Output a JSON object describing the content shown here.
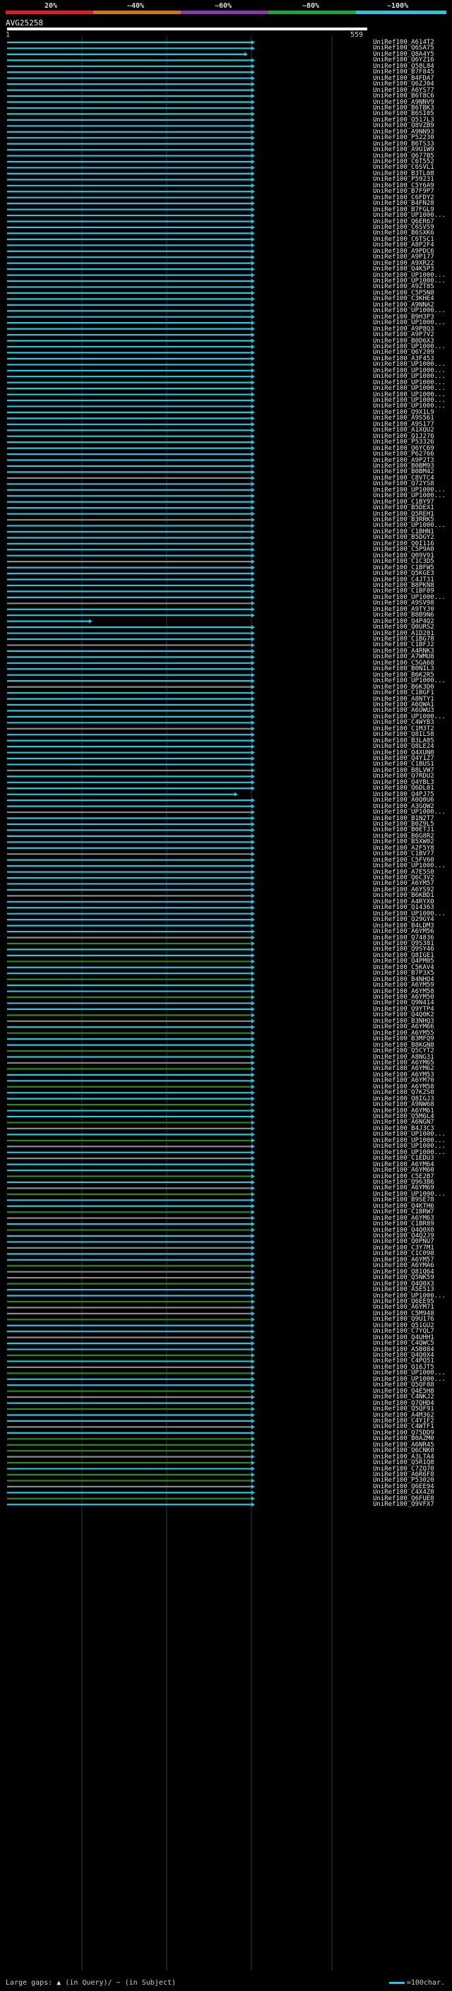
{
  "query": {
    "name": "AVG25258",
    "start": "1",
    "end": "559"
  },
  "scale": {
    "labels": [
      "20%",
      "~40%",
      "~60%",
      "~80%",
      "~100%"
    ],
    "colors": [
      "#e21b1b",
      "#d2741d",
      "#8c34b5",
      "#1fa63a",
      "#27c6e0"
    ]
  },
  "footer": {
    "prefix": "Large gaps:",
    "query_gap": "(in Query)/",
    "subject_gap": "~ (in Subject)",
    "legend": "=100char."
  },
  "colors": {
    "cyan": "#27c6e0",
    "green": "#2f8a16",
    "gray": "#8a8a8a",
    "grid": "#1f3d55"
  },
  "hits": [
    "UniRef100_A614T2",
    "UniRef100_Q6SA75",
    "UniRef100_Q8A4Y5",
    "UniRef100_Q6YZ16",
    "UniRef100_Q58L84",
    "UniRef100_B7F845",
    "UniRef100_B4FDA7",
    "UniRef100_Q6ZJ04",
    "UniRef100_A6YS77",
    "UniRef100_B6T8C6",
    "UniRef100_A9NNV9",
    "UniRef100_B6TBK3",
    "UniRef100_B6SI05",
    "UniRef100_Q517L3",
    "UniRef100_Q8VZB9",
    "UniRef100_A9NN93",
    "UniRef100_P52230",
    "UniRef100_B6TS33",
    "UniRef100_A9U1W9",
    "UniRef100_Q677B5",
    "UniRef100_C6T552",
    "UniRef100_C6SVL1",
    "UniRef100_B3TL08",
    "UniRef100_P59231",
    "UniRef100_C5Y6A9",
    "UniRef100_B7F9P7",
    "UniRef100_C6FDY2",
    "UniRef100_B4FN28",
    "UniRef100_B7FGL9",
    "UniRef100_UP1000...",
    "UniRef100_Q6ER67",
    "UniRef100_C6SVS9",
    "UniRef100_B6SXK6",
    "UniRef100_C6TSC1",
    "UniRef100_A8P2F4",
    "UniRef100_A9PDC6",
    "UniRef100_A9P177",
    "UniRef100_A9XR22",
    "UniRef100_Q4K5P3",
    "UniRef100_UP1000...",
    "UniRef100_UP1000...",
    "UniRef100_A9ZT85",
    "UniRef100_C5P5N8",
    "UniRef100_C3KHE4",
    "UniRef100_A9NNA2",
    "UniRef100_UP1000...",
    "UniRef100_B9H3P3",
    "UniRef100_UP1000...",
    "UniRef100_A9P8Q3",
    "UniRef100_A9P7V2",
    "UniRef100_B0D6X3",
    "UniRef100_UP1000...",
    "UniRef100_Q6Y209",
    "UniRef100_A3F453",
    "UniRef100_UP1000...",
    "UniRef100_UP1000...",
    "UniRef100_UP1000...",
    "UniRef100_UP1000...",
    "UniRef100_UP1000...",
    "UniRef100_UP1000...",
    "UniRef100_UP1000...",
    "UniRef100_UP1000...",
    "UniRef100_Q9X1L9",
    "UniRef100_A9S561",
    "UniRef100_A9S177",
    "UniRef100_A1XQU2",
    "UniRef100_Q1J276",
    "UniRef100_P53326",
    "UniRef100_Q6YC69",
    "UniRef100_P62766",
    "UniRef100_A9P2T3",
    "UniRef100_B0BM93",
    "UniRef100_B0BM42",
    "UniRef100_C8VTC4",
    "UniRef100_Q72YS8",
    "UniRef100_UP1000...",
    "UniRef100_UP1000...",
    "UniRef100_C1BY97",
    "UniRef100_B5DEX1",
    "UniRef100_Q5REH1",
    "UniRef100_B3RRK5",
    "UniRef100_UP1000...",
    "UniRef100_C1BHN1",
    "UniRef100_B5DGY2",
    "UniRef100_Q0I116",
    "UniRef100_C5P9A0",
    "UniRef100_Q09V91",
    "UniRef100_C1C3D5",
    "UniRef100_C1BFW5",
    "UniRef100_Q5KGE3",
    "UniRef100_C4JT31",
    "UniRef100_B8PKN8",
    "UniRef100_C1BF89",
    "UniRef100_UP1000...",
    "UniRef100_A9SV98",
    "UniRef100_A9TYJ0",
    "UniRef100_B8B9N6",
    "UniRef100_Q4P4Q2",
    "UniRef100_Q0URS2",
    "UniRef100_A1D201",
    "UniRef100_C1BG78",
    "UniRef100_C1BFJ2",
    "UniRef100_A4RNK3",
    "UniRef100_A7WMU8",
    "UniRef100_C5GA68",
    "UniRef100_B0NIL3",
    "UniRef100_B6K2R5",
    "UniRef100_UP1000...",
    "UniRef100_B6K3D0",
    "UniRef100_C1BGF1",
    "UniRef100_A8NTY1",
    "UniRef100_A6QWA1",
    "UniRef100_A6UWU3",
    "UniRef100_UP1000...",
    "UniRef100_C4WYB3",
    "UniRef100_C1M3T2",
    "UniRef100_Q8IL58",
    "UniRef100_B3LA05",
    "UniRef100_Q8LE24",
    "UniRef100_Q4XUN0",
    "UniRef100_Q4Y1Z7",
    "UniRef100_C1BUS1",
    "UniRef100_B8LVW7",
    "UniRef100_Q7RDU2",
    "UniRef100_Q4YBL3",
    "UniRef100_Q6DL01",
    "UniRef100_Q4PJ75",
    "UniRef100_A0Q0U6",
    "UniRef100_A3GQW2",
    "UniRef100_UP1000...",
    "UniRef100_B1N2T7",
    "UniRef100_B0Z9L5",
    "UniRef100_B0ETJ1",
    "UniRef100_B6G8R2",
    "UniRef100_B5XW02",
    "UniRef100_A2F5Y8",
    "UniRef100_C1BV77",
    "UniRef100_C5FV60",
    "UniRef100_UP1000...",
    "UniRef100_A7E5S0",
    "UniRef100_Q6C3V2",
    "UniRef100_A6YM57",
    "UniRef100_A6YS92",
    "UniRef100_B6KBD1",
    "UniRef100_A4RYX0",
    "UniRef100_Q14363",
    "UniRef100_UP1000...",
    "UniRef100_Q29GY4",
    "UniRef100_B4LDM3",
    "UniRef100_A6YM56",
    "UniRef100_Q74836",
    "UniRef100_Q9S381",
    "UniRef100_Q9SY46",
    "UniRef100_Q8IGE1",
    "UniRef100_Q4PM05",
    "UniRef100_C5KAV4",
    "UniRef100_B7P3X5",
    "UniRef100_B4NHO4",
    "UniRef100_A6YM59",
    "UniRef100_A6YM58",
    "UniRef100_A6YM50",
    "UniRef100_Q9N414",
    "UniRef100_Q9YTP4",
    "UniRef100_Q4Q0K2",
    "UniRef100_B3NHQ3",
    "UniRef100_A6YM66",
    "UniRef100_A6YM55",
    "UniRef100_B3MFQ9",
    "UniRef100_B8KGN8",
    "UniRef100_Q5CYT2",
    "UniRef100_A8NG31",
    "UniRef100_A6YM65",
    "UniRef100_A6YM62",
    "UniRef100_A6YM53",
    "UniRef100_A6YM70",
    "UniRef100_A6YM58",
    "UniRef100_Q7KZS0",
    "UniRef100_Q8IGJ3",
    "UniRef100_A9NW68",
    "UniRef100_A6YM61",
    "UniRef100_Q5M6L4",
    "UniRef100_A6NGN7",
    "UniRef100_B4J3C3",
    "UniRef100_UP1000...",
    "UniRef100_UP1000...",
    "UniRef100_UP1000...",
    "UniRef100_UP1000...",
    "UniRef100_C1EDU3",
    "UniRef100_A6YM64",
    "UniRef100_A6YM60",
    "UniRef100_C5E2B7",
    "UniRef100_Q963B6",
    "UniRef100_A6YM69",
    "UniRef100_UP1000...",
    "UniRef100_B9SE78",
    "UniRef100_Q4KTH6",
    "UniRef100_C1BRW7",
    "UniRef100_A6YM63",
    "UniRef100_C1BR89",
    "UniRef100_Q4Q0X0",
    "UniRef100_Q4Q2J9",
    "UniRef100_Q0PNU7",
    "UniRef100_C3Y7M1",
    "UniRef100_C1C098",
    "UniRef100_A6YM57",
    "UniRef100_A6YMA6",
    "UniRef100_Q81Q64",
    "UniRef100_Q5NK59",
    "UniRef100_Q4Q0X3",
    "UniRef100_A5E513",
    "UniRef100_UP1000...",
    "UniRef100_Q6EE95",
    "UniRef100_A6YM71",
    "UniRef100_C5M948",
    "UniRef100_Q9U176",
    "UniRef100_Q51GU2",
    "UniRef100_C7YQL7",
    "UniRef100_Q4UHH1",
    "UniRef100_C4QWC5",
    "UniRef100_A5B084",
    "UniRef100_Q4Q0X4",
    "UniRef100_C4PQ51",
    "UniRef100_Q16JT5",
    "UniRef100_UP1000...",
    "UniRef100_UP1000...",
    "UniRef100_Q5QF88",
    "UniRef100_Q4E5H8",
    "UniRef100_C4NKJ2",
    "UniRef100_Q7QHD4",
    "UniRef100_Q5QF91",
    "UniRef100_A4M362",
    "UniRef100_C4Y1F2",
    "UniRef100_C4WTF1",
    "UniRef100_Q75DD9",
    "UniRef100_B0AZM0",
    "UniRef100_A6NR45",
    "UniRef100_Q6CNK0",
    "UniRef100_A3LTA4",
    "UniRef100_Q5R1Q8",
    "UniRef100_C7ZQ70",
    "UniRef100_A6R6F8",
    "UniRef100_P53020",
    "UniRef100_Q6EE94",
    "UniRef100_C4X4Z0",
    "UniRef100_Q6FUE8",
    "UniRef100_Q9VFX7"
  ]
}
